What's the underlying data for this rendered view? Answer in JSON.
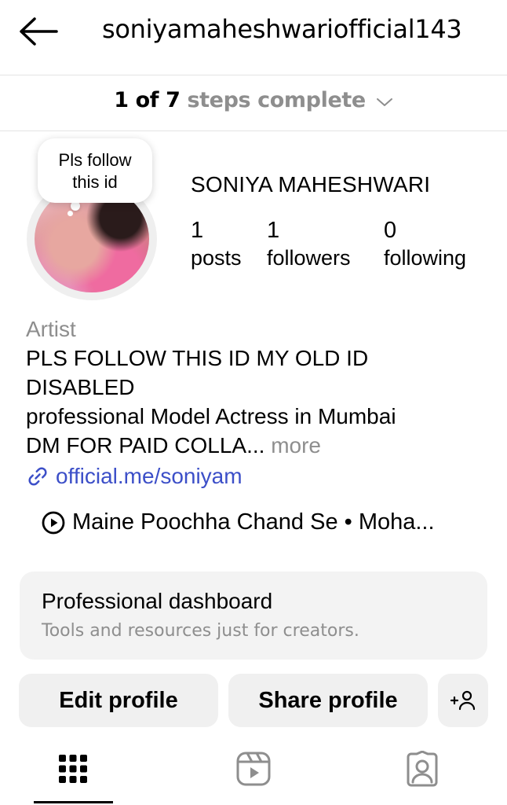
{
  "header": {
    "username": "soniyamaheshwariofficial143",
    "back_icon": "arrow-left-icon"
  },
  "steps": {
    "count": "1 of 7",
    "rest": "steps complete"
  },
  "profile": {
    "note": [
      "Pls follow",
      "this id"
    ],
    "full_name": "SONIYA MAHESHWARI",
    "stats": [
      {
        "value": "1",
        "label": "posts"
      },
      {
        "value": "1",
        "label": "followers"
      },
      {
        "value": "0",
        "label": "following"
      }
    ]
  },
  "bio": {
    "category": "Artist",
    "lines": [
      "PLS FOLLOW THIS ID MY OLD ID",
      "DISABLED",
      "professional Model Actress in Mumbai",
      "DM FOR PAID COLLA..."
    ],
    "more": "more",
    "link": "official.me/soniyam"
  },
  "music": {
    "text": "Maine Poochha Chand Se • Moha..."
  },
  "dashboard": {
    "title": "Professional dashboard",
    "subtitle": "Tools and resources just for creators."
  },
  "actions": {
    "edit": "Edit profile",
    "share": "Share profile"
  },
  "tabs": [
    {
      "icon": "grid-icon",
      "active": true
    },
    {
      "icon": "reels-icon",
      "active": false
    },
    {
      "icon": "tagged-icon",
      "active": false
    }
  ]
}
